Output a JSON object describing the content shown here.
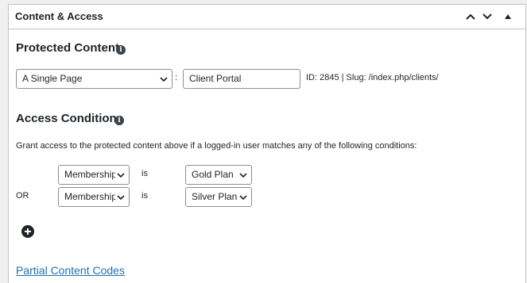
{
  "panel": {
    "title": "Content & Access",
    "controls": [
      "chevron-up",
      "chevron-down",
      "triangle-up"
    ]
  },
  "protected_content": {
    "heading": "Protected Content",
    "type_select": "A Single Page",
    "separator": ":",
    "page_name": "Client Portal",
    "meta": "ID: 2845 | Slug: /index.php/clients/"
  },
  "access_conditions": {
    "heading": "Access Conditions",
    "description": "Grant access to the protected content above if a logged-in user matches any of the following conditions:",
    "conditions": [
      {
        "connector": "",
        "field": "Membership",
        "operator": "is",
        "value": "Gold Plan"
      },
      {
        "connector": "OR",
        "field": "Membership",
        "operator": "is",
        "value": "Silver Plan"
      }
    ]
  },
  "partial_link": "Partial Content Codes",
  "colors": {
    "link": "#2271b1",
    "border": "#c3c4c7",
    "background": "#f0f0f1"
  }
}
